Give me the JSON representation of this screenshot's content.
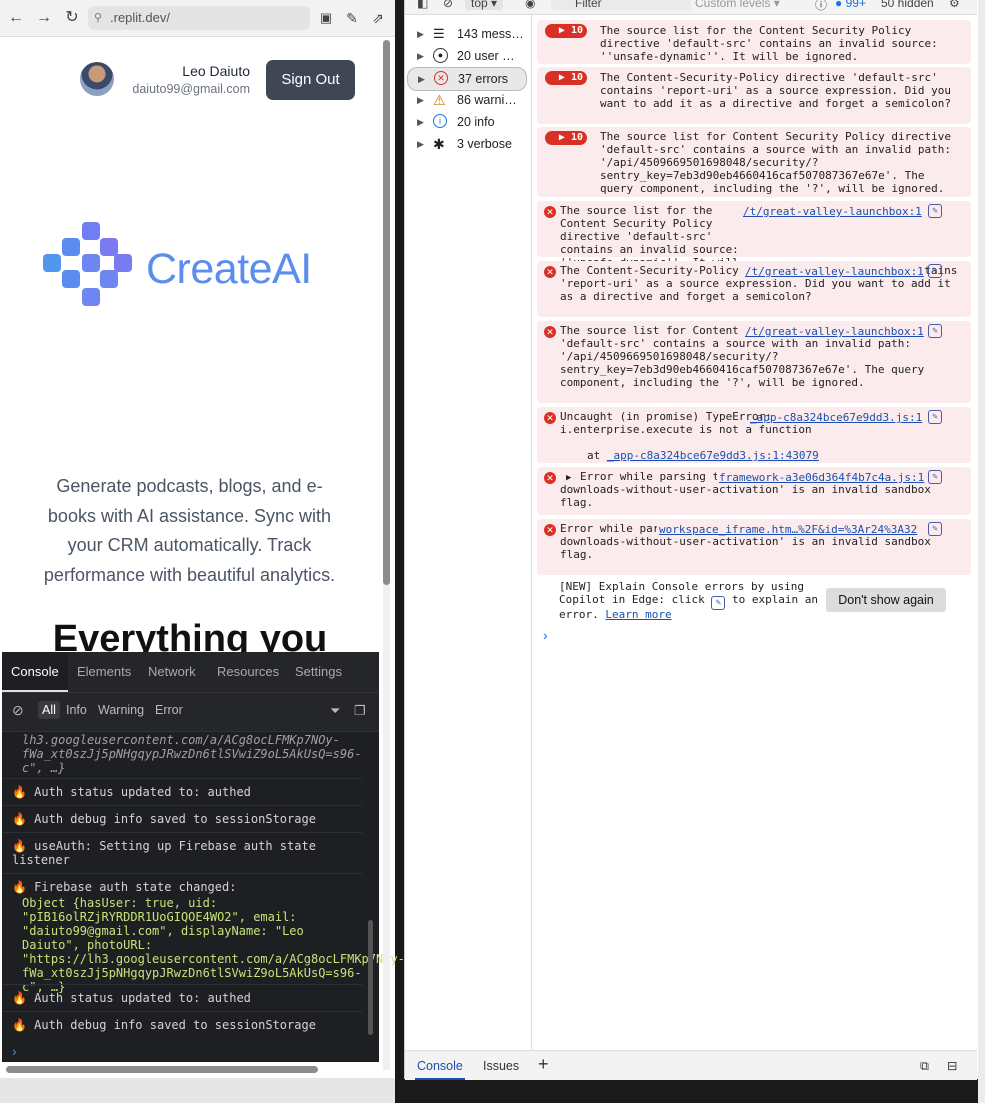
{
  "browser": {
    "url": ".replit.dev/"
  },
  "page": {
    "user_name": "Leo Daiuto",
    "user_email": "daiuto99@gmail.com",
    "sign_out": "Sign Out",
    "logo_text": "CreateAI",
    "tagline_lines": [
      "Generate podcasts, blogs, and e-",
      "books with AI assistance. Sync with",
      "your CRM automatically. Track",
      "performance with beautiful analytics."
    ],
    "hero": "Everything you"
  },
  "mobile_console": {
    "tabs": [
      "Console",
      "Elements",
      "Network",
      "Resources",
      "Settings"
    ],
    "filters": [
      "All",
      "Info",
      "Warning",
      "Error"
    ],
    "logs": {
      "obj_tail_1": "lh3.googleusercontent.com/a/ACg8ocLFMKp7NOy-fWa_xt0szJj5pNHgqypJRwzDn6tlSVwiZ9oL5AkUsQ=s96-c\", …}",
      "auth1": "🔥 Auth status updated to: authed",
      "debug1": "🔥 Auth debug info saved to sessionStorage",
      "useauth": "🔥 useAuth: Setting up Firebase auth state listener",
      "fbchanged": "🔥 Firebase auth state changed:",
      "obj_full": "Object {hasUser: true, uid: \"pIB16olRZjRYRDDR1UoGIQOE4WO2\", email: \"daiuto99@gmail.com\", displayName: \"Leo Daiuto\", photoURL: \"https://lh3.googleusercontent.com/a/ACg8ocLFMKp7NOy-fWa_xt0szJj5pNHgqypJRwzDn6tlSVwiZ9oL5AkUsQ=s96-c\", …}",
      "auth2": "🔥 Auth status updated to: authed",
      "debug2": "🔥 Auth debug info saved to sessionStorage"
    }
  },
  "devtools": {
    "top": {
      "context": "top",
      "filter_placeholder": "Filter",
      "levels": "Custom levels",
      "issues_count": "99+",
      "hidden": "50 hidden"
    },
    "sidebar": [
      {
        "label": "143 mess…",
        "icon": "list-icon"
      },
      {
        "label": "20 user …",
        "icon": "user-icon"
      },
      {
        "label": "37 errors",
        "icon": "error-icon"
      },
      {
        "label": "86 warni…",
        "icon": "warning-icon"
      },
      {
        "label": "20 info",
        "icon": "info-icon"
      },
      {
        "label": "3 verbose",
        "icon": "bug-icon"
      }
    ],
    "messages": [
      {
        "count": "10",
        "text": "The source list for the Content Security Policy directive 'default-src' contains an invalid source: ''unsafe-dynamic''. It will be ignored."
      },
      {
        "count": "10",
        "text": "The Content-Security-Policy directive 'default-src' contains 'report-uri' as a source expression. Did you want to add it as a directive and forget a semicolon?"
      },
      {
        "count": "10",
        "text": "The source list for Content Security Policy directive 'default-src' contains a source with an invalid path: '/api/4509669501698048/security/?sentry_key=7eb3d90eb4660416caf507087367e67e'. The query component, including the '?', will be ignored."
      },
      {
        "source": "/t/great-valley-launchbox:1",
        "text": "The source list for the Content Security Policy directive 'default-src' contains an invalid source: ''unsafe-dynamic''. It will be ignored."
      },
      {
        "source": "/t/great-valley-launchbox:1",
        "text": "The Content-Security-Policy directive 'default-src' contains 'report-uri' as a source expression. Did you want to add it as a directive and forget a semicolon?"
      },
      {
        "source": "/t/great-valley-launchbox:1",
        "text": "The source list for Content Security Policy directive 'default-src' contains a source with an invalid path: '/api/4509669501698048/security/?sentry_key=7eb3d90eb4660416caf507087367e67e'. The query component, including the '?', will be ignored."
      },
      {
        "source": "_app-c8a324bce67e9dd3.js:1",
        "text": "Uncaught (in promise) TypeError: i.enterprise.execute is not a function",
        "stack_prefix": "at ",
        "stack_link": "_app-c8a324bce67e9dd3.js:1:43079"
      },
      {
        "source": "framework-a3e06d364f4b7c4a.js:1",
        "text": "Error while parsing the 'sandbox' attribute: 'allow-downloads-without-user-activation' is an invalid sandbox flag."
      },
      {
        "source": "workspace_iframe.htm…%2F&id=%3Ar24%3A32",
        "text": "Error while parsing the 'sandbox' attribute: 'allow-downloads-without-user-activation' is an invalid sandbox flag."
      }
    ],
    "copilot": {
      "text_a": "[NEW] Explain Console errors by using Copilot in Edge: click",
      "text_b": "to explain an error.",
      "learn_more": "Learn more",
      "dont_show": "Don't show again"
    },
    "bottom_tabs": [
      "Console",
      "Issues"
    ],
    "add_tab": "+"
  }
}
